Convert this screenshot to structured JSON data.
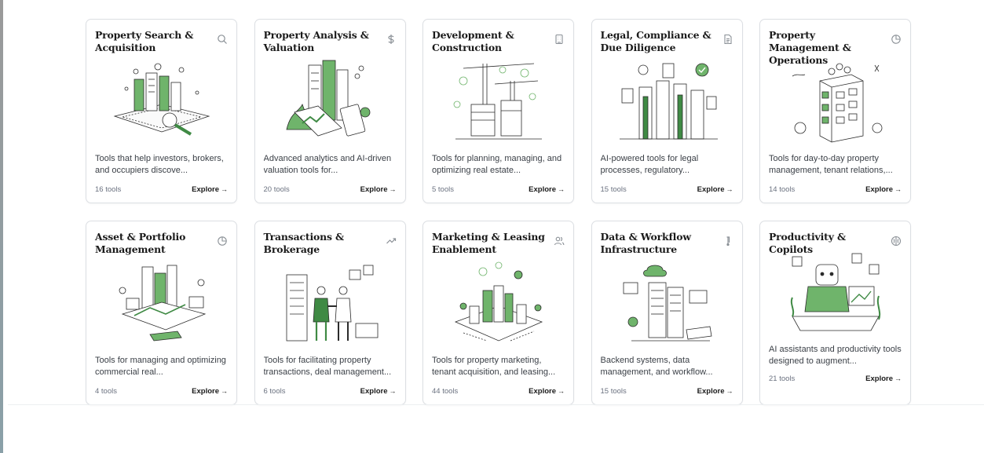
{
  "categories": [
    {
      "title": "Property Search & Acquisition",
      "icon": "search-icon",
      "description": "Tools that help investors, brokers, and occupiers discove...",
      "count": "16 tools",
      "explore": "Explore"
    },
    {
      "title": "Property Analysis & Valuation",
      "icon": "dollar-icon",
      "description": "Advanced analytics and AI-driven valuation tools for...",
      "count": "20 tools",
      "explore": "Explore"
    },
    {
      "title": "Development & Construction",
      "icon": "building-icon",
      "description": "Tools for planning, managing, and optimizing real estate...",
      "count": "5 tools",
      "explore": "Explore"
    },
    {
      "title": "Legal, Compliance & Due Diligence",
      "icon": "document-icon",
      "description": "AI-powered tools for legal processes, regulatory...",
      "count": "15 tools",
      "explore": "Explore"
    },
    {
      "title": "Property Management & Operations",
      "icon": "pie-chart-icon",
      "description": "Tools for day-to-day property management, tenant relations,...",
      "count": "14 tools",
      "explore": "Explore"
    },
    {
      "title": "Asset & Portfolio Management",
      "icon": "pie-chart-icon",
      "description": "Tools for managing and optimizing commercial real...",
      "count": "4 tools",
      "explore": "Explore"
    },
    {
      "title": "Transactions & Brokerage",
      "icon": "trending-up-icon",
      "description": "Tools for facilitating property transactions, deal management...",
      "count": "6 tools",
      "explore": "Explore"
    },
    {
      "title": "Marketing & Leasing Enablement",
      "icon": "users-icon",
      "description": "Tools for property marketing, tenant acquisition, and leasing...",
      "count": "44 tools",
      "explore": "Explore"
    },
    {
      "title": "Data & Workflow Infrastructure",
      "icon": "thermometer-icon",
      "description": "Backend systems, data management, and workflow...",
      "count": "15 tools",
      "explore": "Explore"
    },
    {
      "title": "Productivity & Copilots",
      "icon": "brain-icon",
      "description": "AI assistants and productivity tools designed to augment...",
      "count": "21 tools",
      "explore": "Explore"
    }
  ],
  "colors": {
    "accent_green": "#6fb46b",
    "dark_green": "#3f8a44",
    "line": "#2b2b2b",
    "border": "#dcdfe3"
  }
}
